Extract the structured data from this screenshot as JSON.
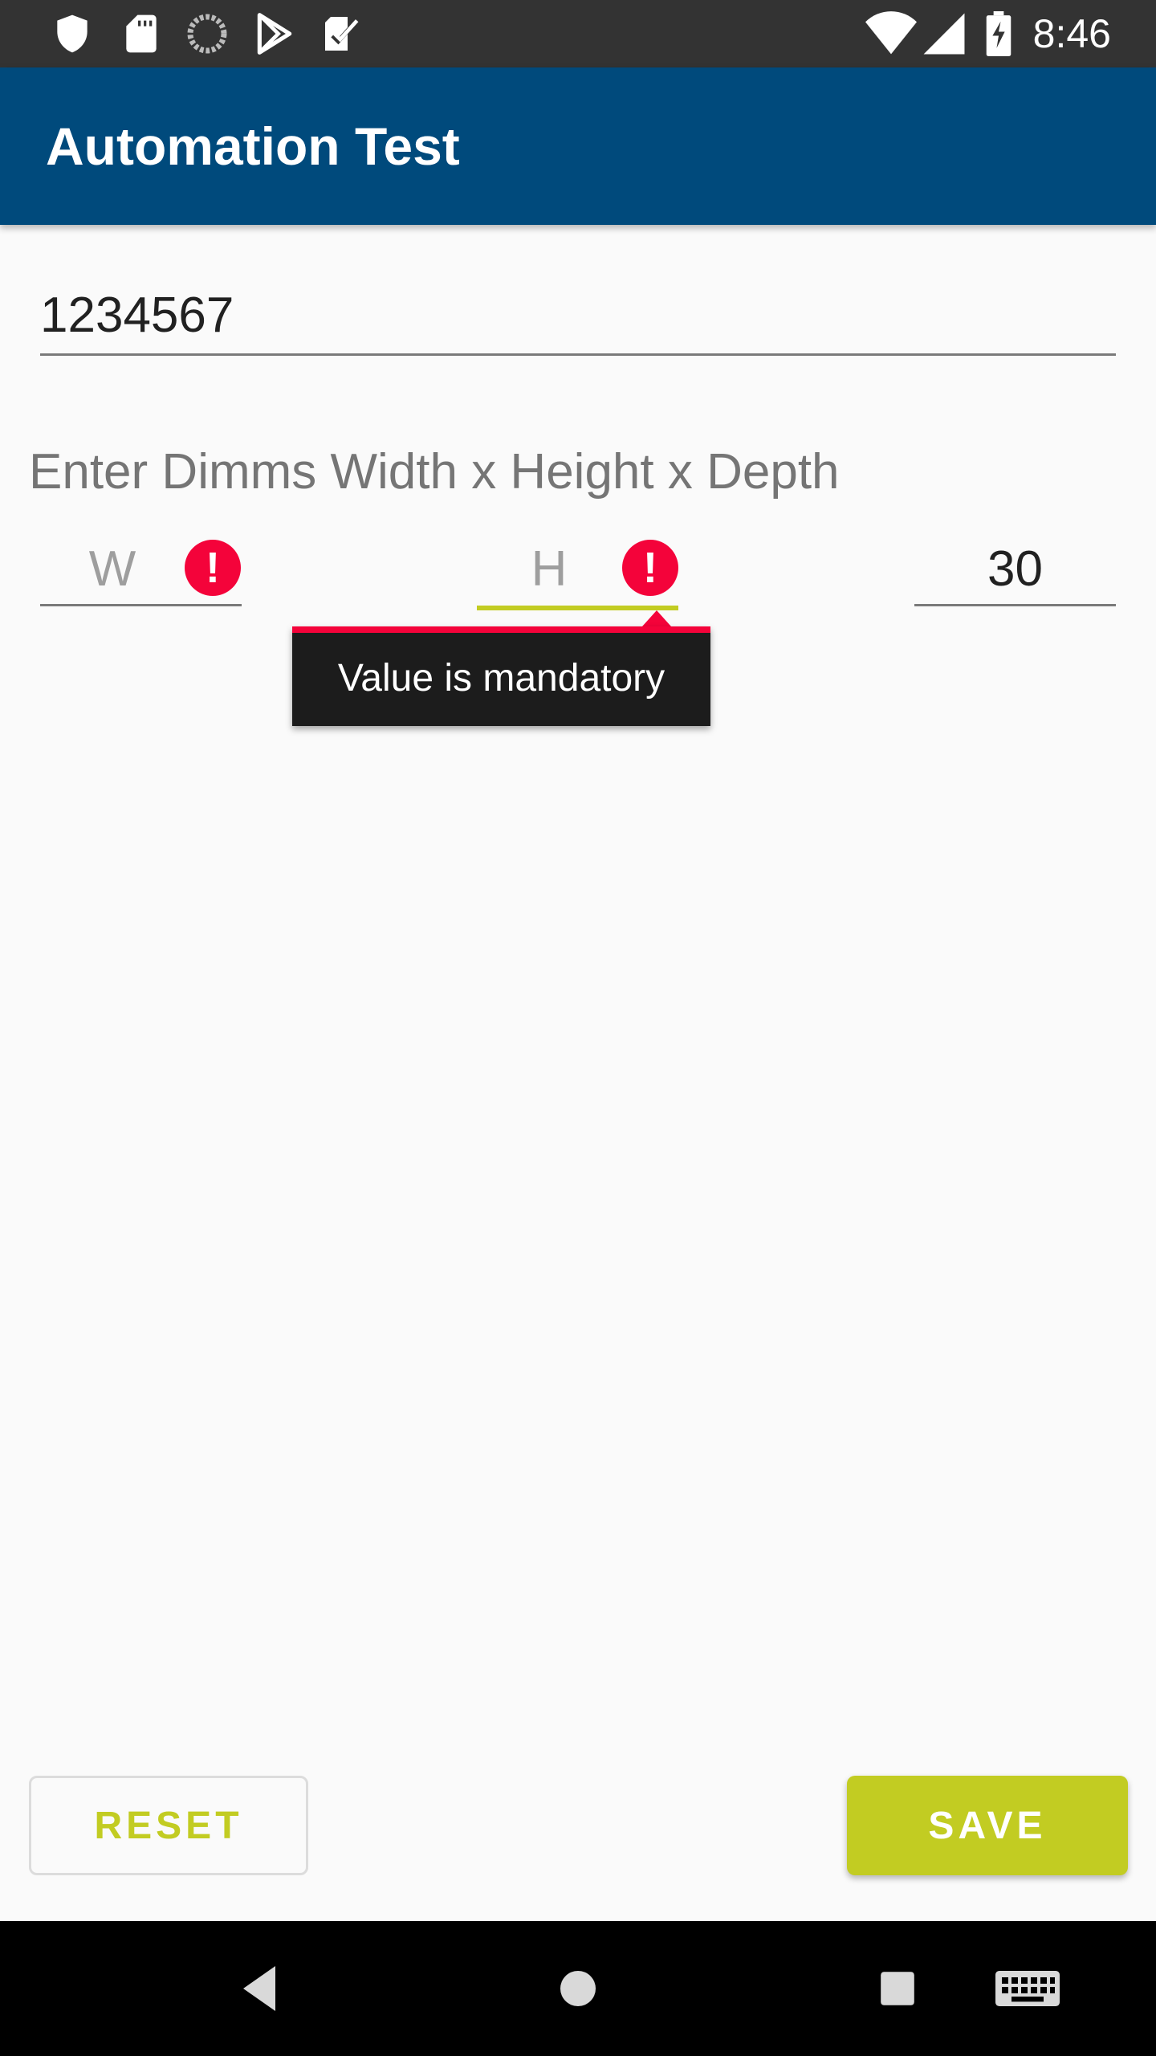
{
  "status_bar": {
    "time": "8:46",
    "left_icons": [
      "shield-icon",
      "sd-card-icon",
      "sync-icon",
      "play-store-icon",
      "checklist-icon"
    ],
    "right_icons": [
      "wifi-icon",
      "cell-signal-icon",
      "battery-charging-icon"
    ],
    "background": "#333333"
  },
  "app_bar": {
    "title": "Automation Test",
    "background": "#004a7c"
  },
  "form": {
    "id_value": "1234567",
    "dims_label": "Enter Dimms Width x Height x Depth",
    "width": {
      "value": "",
      "placeholder": "W",
      "error": true
    },
    "height": {
      "value": "",
      "placeholder": "H",
      "error": true,
      "focused": true
    },
    "depth": {
      "value": "30",
      "placeholder": ""
    },
    "error_message": "Value is mandatory"
  },
  "buttons": {
    "reset": "RESET",
    "save": "SAVE"
  },
  "colors": {
    "accent": "#c2cc22",
    "error": "#f4033a"
  },
  "nav_bar": {
    "icons": [
      "back-icon",
      "home-icon",
      "recents-icon",
      "keyboard-icon"
    ]
  }
}
